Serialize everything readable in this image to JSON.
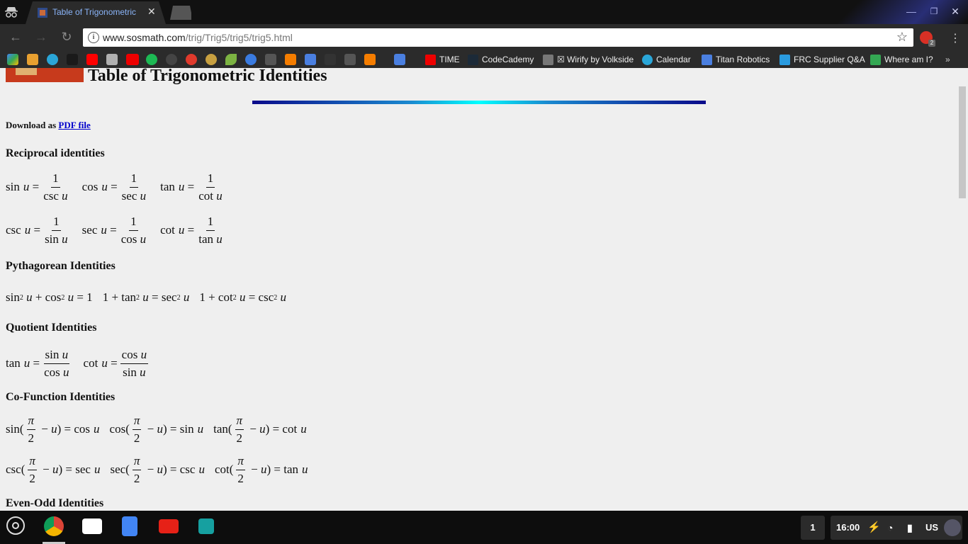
{
  "browser": {
    "tab_title": "Table of Trigonometric",
    "url_host": "www.sosmath.com",
    "url_path": "/trig/Trig5/trig5/trig5.html",
    "ext_badge": "2",
    "bookmarks": [
      "TIME",
      "CodeCademy",
      "☒ Wirify by Volkside",
      "Calendar",
      "Titan Robotics",
      "FRC Supplier Q&A",
      "Where am I?"
    ]
  },
  "page": {
    "title": "Table of Trigonometric Identities",
    "download_prefix": "Download as",
    "download_link": "PDF file",
    "sections": {
      "reciprocal": "Reciprocal identities",
      "pythagorean": "Pythagorean Identities",
      "quotient": "Quotient Identities",
      "cofunction": "Co-Function Identities",
      "evenodd": "Even-Odd Identities"
    }
  },
  "shelf": {
    "notification_count": "1",
    "clock": "16:00",
    "input_method": "US"
  },
  "colors": {
    "accent_link": "#0000cc",
    "rule_start": "#0a0a8a",
    "rule_mid": "#00ffff"
  }
}
